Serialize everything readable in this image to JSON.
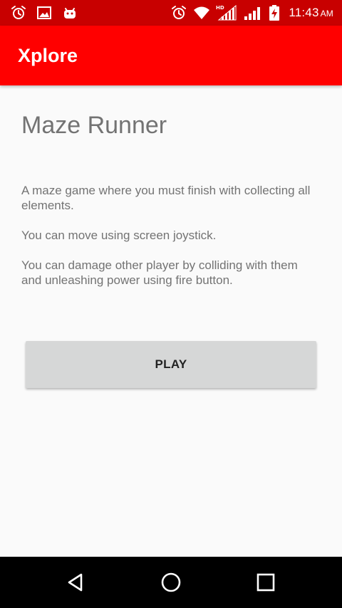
{
  "status_bar": {
    "time": "11:43",
    "ampm": "AM",
    "left_icons": [
      "alarm-icon",
      "image-icon",
      "android-icon"
    ],
    "right_icons": [
      "alarm-icon",
      "wifi-icon",
      "signal-hd-icon",
      "signal-icon",
      "battery-charging-icon"
    ],
    "network_badge": "HD",
    "background_color": "#c80000"
  },
  "app_bar": {
    "title": "Xplore",
    "background_color": "#ff0000"
  },
  "game": {
    "title": "Maze Runner",
    "description": [
      "A maze game where you must finish with collecting all elements.",
      "You can move using screen joystick.",
      "You can damage other player by colliding with them and unleashing power using fire button."
    ],
    "play_label": "PLAY"
  },
  "nav_bar": {
    "buttons": [
      "back-icon",
      "home-icon",
      "recents-icon"
    ]
  }
}
